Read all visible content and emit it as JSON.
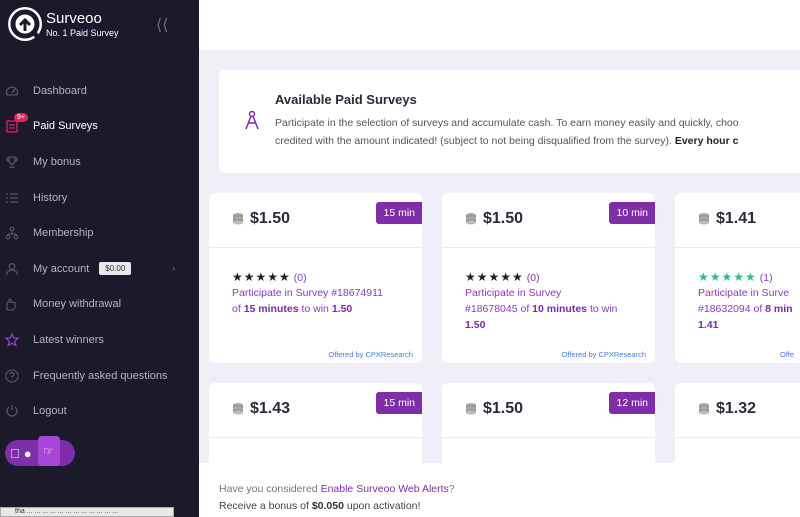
{
  "brand": {
    "name": "Surveoo",
    "tagline": "No. 1 Paid Survey"
  },
  "sidebar": {
    "items": [
      {
        "label": "Dashboard",
        "icon": "gauge-icon"
      },
      {
        "label": "Paid Surveys",
        "icon": "survey-icon",
        "badge": "9+",
        "active": true
      },
      {
        "label": "My bonus",
        "icon": "trophy-icon"
      },
      {
        "label": "History",
        "icon": "list-icon"
      },
      {
        "label": "Membership",
        "icon": "network-icon"
      },
      {
        "label": "My account",
        "icon": "user-icon",
        "balance": "$0.00"
      },
      {
        "label": "Money withdrawal",
        "icon": "hand-icon"
      },
      {
        "label": "Latest winners",
        "icon": "star-icon"
      },
      {
        "label": "Frequently asked questions",
        "icon": "question-icon"
      },
      {
        "label": "Logout",
        "icon": "logout-icon"
      }
    ],
    "tooltip": "tha ... ... ... ... ... ... ... ... ... ... ... ..."
  },
  "info": {
    "title": "Available Paid Surveys",
    "line1": "Participate in the selection of surveys and accumulate cash. To earn money easily and quickly, choo",
    "line2": "credited with the amount indicated! (subject to not being disqualified from the survey).",
    "line2_bold": "Every hour c"
  },
  "cards": [
    {
      "price": "$1.50",
      "time": "15 min",
      "stars": "★★★★★",
      "count": "(0)",
      "line1": "Participate in Survey #18674911",
      "of": "of",
      "minutes": "15 minutes",
      "win": "to win",
      "amount": "1.50",
      "offered": "Offered by CPXResearch"
    },
    {
      "price": "$1.50",
      "time": "10 min",
      "stars": "★★★★★",
      "count": "(0)",
      "line1": "Participate in Survey",
      "line1b": "#18678045",
      "of": "of",
      "minutes": "10 minutes",
      "win": "to win",
      "amount": "1.50",
      "offered": "Offered by CPXResearch"
    },
    {
      "price": "$1.41",
      "stars": "★★★★★",
      "count": "(1)",
      "line1": "Participate in Surve",
      "line1b": "#18632094",
      "of": "of",
      "minutes": "8 min",
      "amount": "1.41",
      "offered": "Offe"
    },
    {
      "price": "$1.43",
      "time": "15 min"
    },
    {
      "price": "$1.50",
      "time": "12 min"
    },
    {
      "price": "$1.32"
    }
  ],
  "banner": {
    "q_pre": "Have you considered",
    "q_link": "Enable Surveoo Web Alerts",
    "q_post": "?",
    "b_pre": "Receive a bonus of",
    "b_amount": "$0.050",
    "b_post": "upon activation!"
  },
  "colors": {
    "accent": "#7e2ea8",
    "sidebar": "#1c1a2a",
    "badge": "#e2245b",
    "link": "#4a7bd6"
  }
}
